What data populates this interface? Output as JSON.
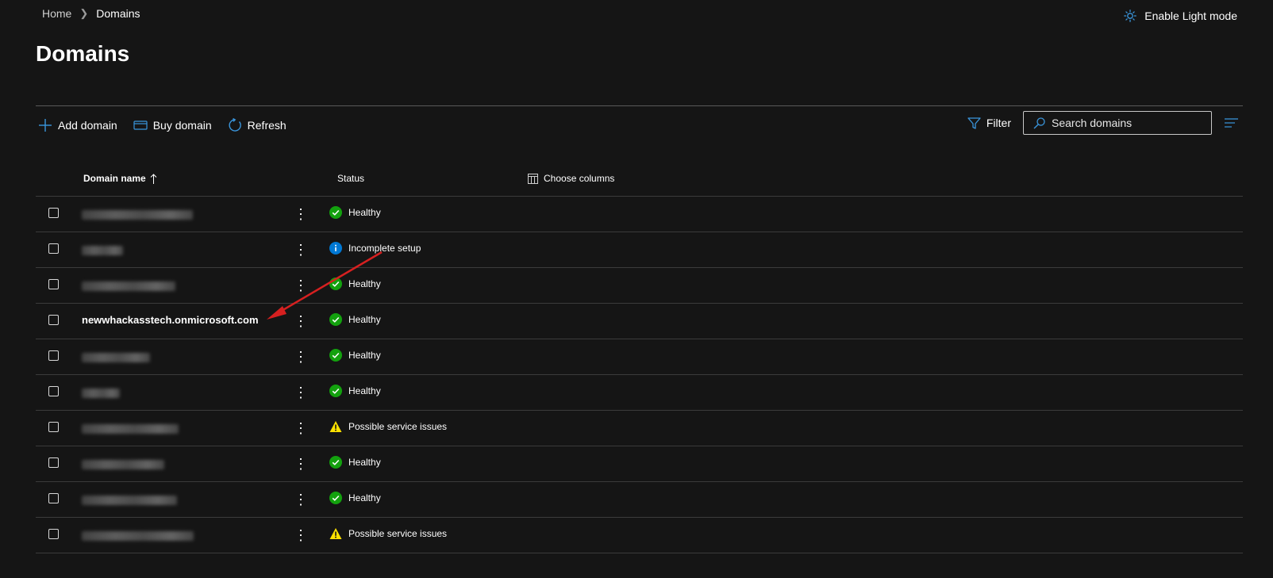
{
  "breadcrumb": {
    "home": "Home",
    "current": "Domains"
  },
  "light_mode": {
    "label": "Enable Light mode",
    "icon": "sun-icon"
  },
  "page_title": "Domains",
  "toolbar": {
    "add_label": "Add domain",
    "buy_label": "Buy domain",
    "refresh_label": "Refresh",
    "filter_label": "Filter",
    "search_placeholder": "Search domains"
  },
  "table": {
    "col_name": "Domain name",
    "col_status": "Status",
    "choose_columns": "Choose columns",
    "rows": [
      {
        "name": "",
        "status": "Healthy",
        "status_type": "healthy"
      },
      {
        "name": "",
        "status": "Incomplete setup",
        "status_type": "info"
      },
      {
        "name": "",
        "status": "Healthy",
        "status_type": "healthy"
      },
      {
        "name": "newwhackasstech.onmicrosoft.com",
        "status": "Healthy",
        "status_type": "healthy"
      },
      {
        "name": "",
        "status": "Healthy",
        "status_type": "healthy"
      },
      {
        "name": "",
        "status": "Healthy",
        "status_type": "healthy"
      },
      {
        "name": "",
        "status": "Possible service issues",
        "status_type": "warning"
      },
      {
        "name": "",
        "status": "Healthy",
        "status_type": "healthy"
      },
      {
        "name": "",
        "status": "Healthy",
        "status_type": "healthy"
      },
      {
        "name": "",
        "status": "Possible service issues",
        "status_type": "warning"
      }
    ]
  },
  "colors": {
    "accent": "#3a96dd",
    "healthy": "#13a10e",
    "info": "#0078d4",
    "warning": "#fce100",
    "annotation_arrow": "#d62020"
  }
}
